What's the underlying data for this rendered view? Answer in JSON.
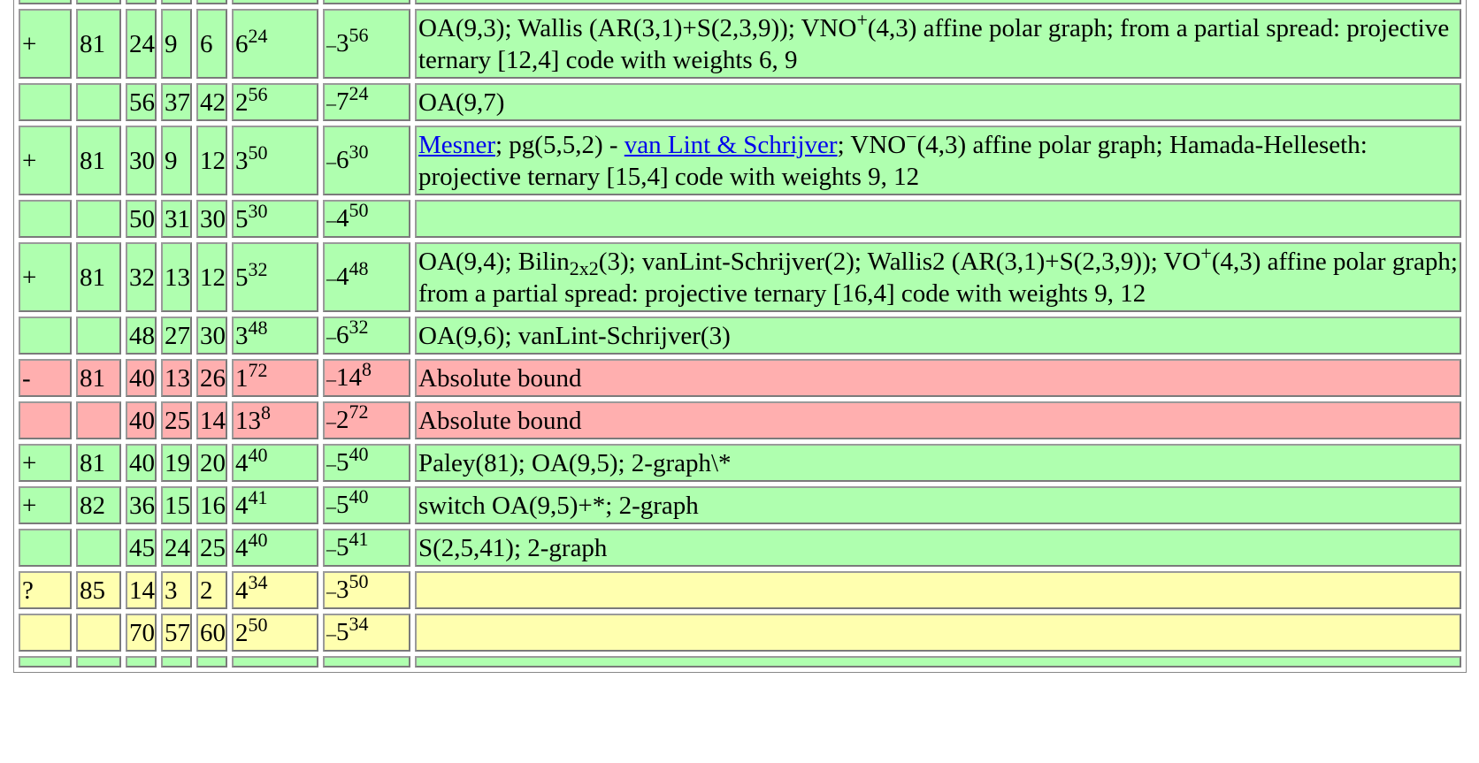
{
  "rows": [
    {
      "cls": "g",
      "mark": "+",
      "v": "81",
      "k": "24",
      "lambda": "9",
      "mu": "6",
      "r": "6",
      "f": "24",
      "s": "3",
      "g": "56",
      "comment": [
        {
          "t": "OA(9,3); Wallis (AR(3,1)+S(2,3,9)); VNO"
        },
        {
          "t": "+",
          "sup": true
        },
        {
          "t": "(4,3) affine polar graph; from a partial spread: projective ternary [12,4] code with weights 6, 9"
        }
      ]
    },
    {
      "cls": "g",
      "mark": "",
      "v": "",
      "k": "56",
      "lambda": "37",
      "mu": "42",
      "r": "2",
      "f": "56",
      "s": "7",
      "g": "24",
      "comment": [
        {
          "t": "OA(9,7)"
        }
      ]
    },
    {
      "cls": "g",
      "mark": "+",
      "v": "81",
      "k": "30",
      "lambda": "9",
      "mu": "12",
      "r": "3",
      "f": "50",
      "s": "6",
      "g": "30",
      "comment": [
        {
          "t": "Mesner",
          "link": true
        },
        {
          "t": "; pg(5,5,2) - "
        },
        {
          "t": "van Lint & Schrijver",
          "link": true
        },
        {
          "t": "; VNO"
        },
        {
          "t": "−",
          "sup": true
        },
        {
          "t": "(4,3) affine polar graph; Hamada-Helleseth: projective ternary [15,4] code with weights 9, 12"
        }
      ]
    },
    {
      "cls": "g",
      "mark": "",
      "v": "",
      "k": "50",
      "lambda": "31",
      "mu": "30",
      "r": "5",
      "f": "30",
      "s": "4",
      "g": "50",
      "comment": []
    },
    {
      "cls": "g",
      "mark": "+",
      "v": "81",
      "k": "32",
      "lambda": "13",
      "mu": "12",
      "r": "5",
      "f": "32",
      "s": "4",
      "g": "48",
      "comment": [
        {
          "t": "OA(9,4); Bilin"
        },
        {
          "t": "2x2",
          "sub": true
        },
        {
          "t": "(3); vanLint-Schrijver(2); Wallis2 (AR(3,1)+S(2,3,9)); VO"
        },
        {
          "t": "+",
          "sup": true
        },
        {
          "t": "(4,3) affine polar graph; from a partial spread: projective ternary [16,4] code with weights 9, 12"
        }
      ]
    },
    {
      "cls": "g",
      "mark": "",
      "v": "",
      "k": "48",
      "lambda": "27",
      "mu": "30",
      "r": "3",
      "f": "48",
      "s": "6",
      "g": "32",
      "comment": [
        {
          "t": "OA(9,6); vanLint-Schrijver(3)"
        }
      ]
    },
    {
      "cls": "r",
      "mark": "-",
      "v": "81",
      "k": "40",
      "lambda": "13",
      "mu": "26",
      "r": "1",
      "f": "72",
      "s": "14",
      "g": "8",
      "comment": [
        {
          "t": "Absolute bound"
        }
      ]
    },
    {
      "cls": "r",
      "mark": "",
      "v": "",
      "k": "40",
      "lambda": "25",
      "mu": "14",
      "r": "13",
      "f": "8",
      "s": "2",
      "g": "72",
      "comment": [
        {
          "t": "Absolute bound"
        }
      ]
    },
    {
      "cls": "g",
      "mark": "+",
      "v": "81",
      "k": "40",
      "lambda": "19",
      "mu": "20",
      "r": "4",
      "f": "40",
      "s": "5",
      "g": "40",
      "comment": [
        {
          "t": "Paley(81); OA(9,5); 2-graph\\*"
        }
      ]
    },
    {
      "cls": "g",
      "mark": "+",
      "v": "82",
      "k": "36",
      "lambda": "15",
      "mu": "16",
      "r": "4",
      "f": "41",
      "s": "5",
      "g": "40",
      "comment": [
        {
          "t": "switch OA(9,5)+*; 2-graph"
        }
      ]
    },
    {
      "cls": "g",
      "mark": "",
      "v": "",
      "k": "45",
      "lambda": "24",
      "mu": "25",
      "r": "4",
      "f": "40",
      "s": "5",
      "g": "41",
      "comment": [
        {
          "t": "S(2,5,41); 2-graph"
        }
      ]
    },
    {
      "cls": "y",
      "mark": "?",
      "v": "85",
      "k": "14",
      "lambda": "3",
      "mu": "2",
      "r": "4",
      "f": "34",
      "s": "3",
      "g": "50",
      "comment": []
    },
    {
      "cls": "y",
      "mark": "",
      "v": "",
      "k": "70",
      "lambda": "57",
      "mu": "60",
      "r": "2",
      "f": "50",
      "s": "5",
      "g": "34",
      "comment": []
    }
  ],
  "minus_sign": "–"
}
